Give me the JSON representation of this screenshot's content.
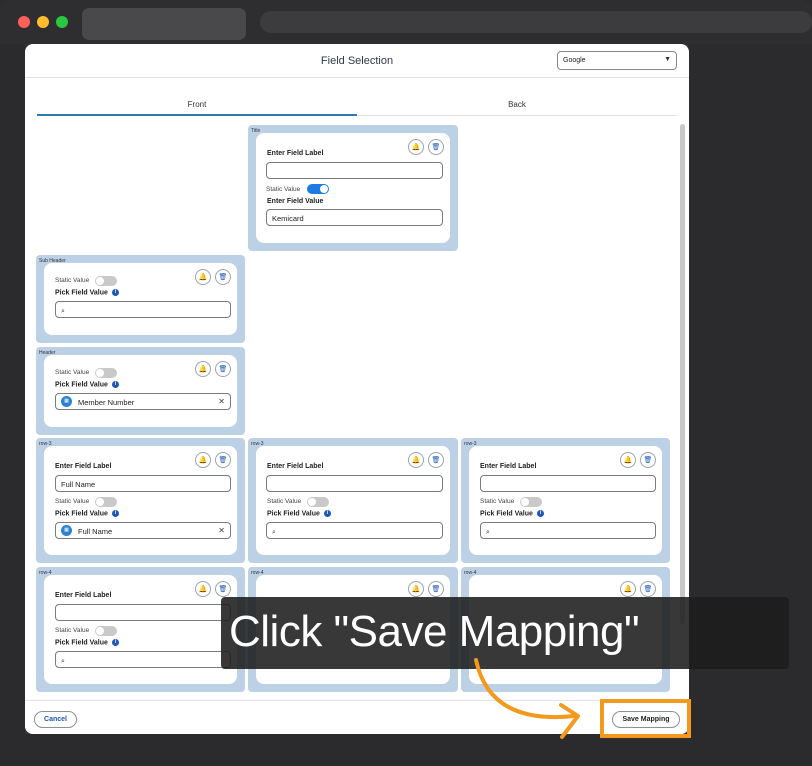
{
  "modal": {
    "title": "Field Selection",
    "provider_select": "Google",
    "tabs": [
      {
        "label": "Front"
      },
      {
        "label": "Back"
      }
    ]
  },
  "blocks": {
    "title": {
      "name": "Title",
      "label_heading": "Enter Field Label",
      "label_value": "",
      "static_label": "Static Value",
      "static_on": true,
      "value_heading": "Enter Field Value",
      "value": "Kemicard"
    },
    "subheader": {
      "name": "Sub Header",
      "static_label": "Static Value",
      "pick_heading": "Pick Field Value",
      "pick_value": ""
    },
    "header": {
      "name": "Header",
      "static_label": "Static Value",
      "pick_heading": "Pick Field Value",
      "pick_value": "Member Number"
    },
    "row3a": {
      "name": "row-3",
      "label_heading": "Enter Field Label",
      "label_value": "Full Name",
      "static_label": "Static Value",
      "pick_heading": "Pick Field Value",
      "pick_value": "Full Name"
    },
    "row3b": {
      "name": "row-3",
      "label_heading": "Enter Field Label",
      "label_value": "",
      "static_label": "Static Value",
      "pick_heading": "Pick Field Value",
      "pick_value": ""
    },
    "row3c": {
      "name": "row-3",
      "label_heading": "Enter Field Label",
      "label_value": "",
      "static_label": "Static Value",
      "pick_heading": "Pick Field Value",
      "pick_value": ""
    },
    "row4a": {
      "name": "row-4",
      "label_heading": "Enter Field Label",
      "label_value": "",
      "static_label": "Static Value",
      "pick_heading": "Pick Field Value",
      "pick_value": ""
    },
    "row4b": {
      "name": "row-4"
    },
    "row4c": {
      "name": "row-4"
    }
  },
  "footer": {
    "cancel_label": "Cancel",
    "save_label": "Save Mapping"
  },
  "tutorial": {
    "instruction": "Click \"Save Mapping\"",
    "highlight_color": "#f3991b"
  },
  "colors": {
    "accent": "#1c56b8",
    "toggle_on": "#1b7de3",
    "block_bg": "#bcd0e6",
    "tab_underline": "#2f7ab0"
  },
  "icons": {
    "bell": "bell-icon",
    "trash": "trash-icon",
    "search": "search-icon",
    "info": "info-icon",
    "clear": "close-icon",
    "entity": "entity-icon",
    "dropdown": "chevron-down-icon"
  }
}
